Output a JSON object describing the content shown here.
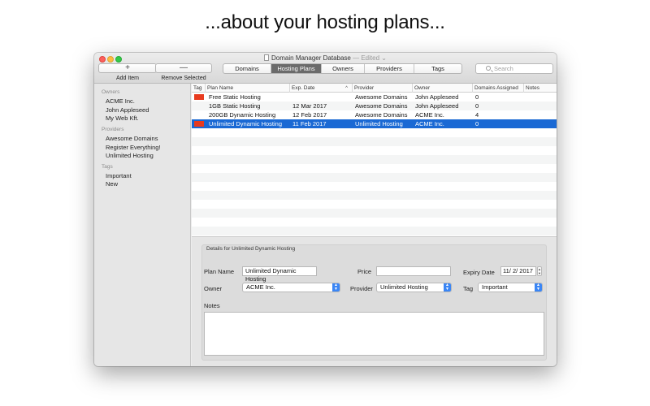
{
  "headline": "...about your hosting plans...",
  "window": {
    "title": "Domain Manager Database",
    "edited": "— Edited ⌄"
  },
  "toolbar": {
    "add_icon": "+",
    "add_label": "Add Item",
    "remove_icon": "—",
    "remove_label": "Remove Selected",
    "tabs": [
      "Domains",
      "Hosting Plans",
      "Owners",
      "Providers",
      "Tags"
    ],
    "active_tab": "Hosting Plans",
    "search_placeholder": "Search"
  },
  "sidebar": {
    "sections": [
      {
        "header": "Owners",
        "items": [
          "ACME Inc.",
          "John Appleseed",
          "My Web Kft."
        ]
      },
      {
        "header": "Providers",
        "items": [
          "Awesome Domains",
          "Register Everything!",
          "Unlimited Hosting"
        ]
      },
      {
        "header": "Tags",
        "items": [
          "Important",
          "New"
        ]
      }
    ]
  },
  "table": {
    "columns": [
      "Tag",
      "Plan Name",
      "Exp. Date",
      "Provider",
      "Owner",
      "Domains Assigned",
      "Notes"
    ],
    "sort_indicator": "^",
    "rows": [
      {
        "tag_color": "#e83b1f",
        "plan_name": "Free Static Hosting",
        "exp_date": "",
        "provider": "Awesome Domains",
        "owner": "John Appleseed",
        "domains": "0",
        "notes": ""
      },
      {
        "tag_color": "",
        "plan_name": "1GB Static Hosting",
        "exp_date": "12 Mar 2017",
        "provider": "Awesome Domains",
        "owner": "John Appleseed",
        "domains": "0",
        "notes": ""
      },
      {
        "tag_color": "",
        "plan_name": "200GB Dynamic Hosting",
        "exp_date": "12 Feb 2017",
        "provider": "Awesome Domains",
        "owner": "ACME Inc.",
        "domains": "4",
        "notes": ""
      },
      {
        "tag_color": "#e83b1f",
        "plan_name": "Unlimited Dynamic Hosting",
        "exp_date": "11 Feb 2017",
        "provider": "Unlimited Hosting",
        "owner": "ACME Inc.",
        "domains": "0",
        "notes": "",
        "selected": true
      }
    ]
  },
  "detail": {
    "title": "Details for Unlimited Dynamic Hosting",
    "plan_name_label": "Plan Name",
    "plan_name_value": "Unlimited Dynamic Hosting",
    "price_label": "Price",
    "price_value": "",
    "expiry_label": "Expiry Date",
    "expiry_value": "11/ 2/ 2017",
    "owner_label": "Owner",
    "owner_value": "ACME Inc.",
    "provider_label": "Provider",
    "provider_value": "Unlimited Hosting",
    "tag_label": "Tag",
    "tag_value": "Important",
    "notes_label": "Notes",
    "notes_value": ""
  },
  "colors": {
    "selection": "#1a69d4",
    "tag_red": "#e83b1f",
    "popup_accent": "#3b86f5"
  }
}
